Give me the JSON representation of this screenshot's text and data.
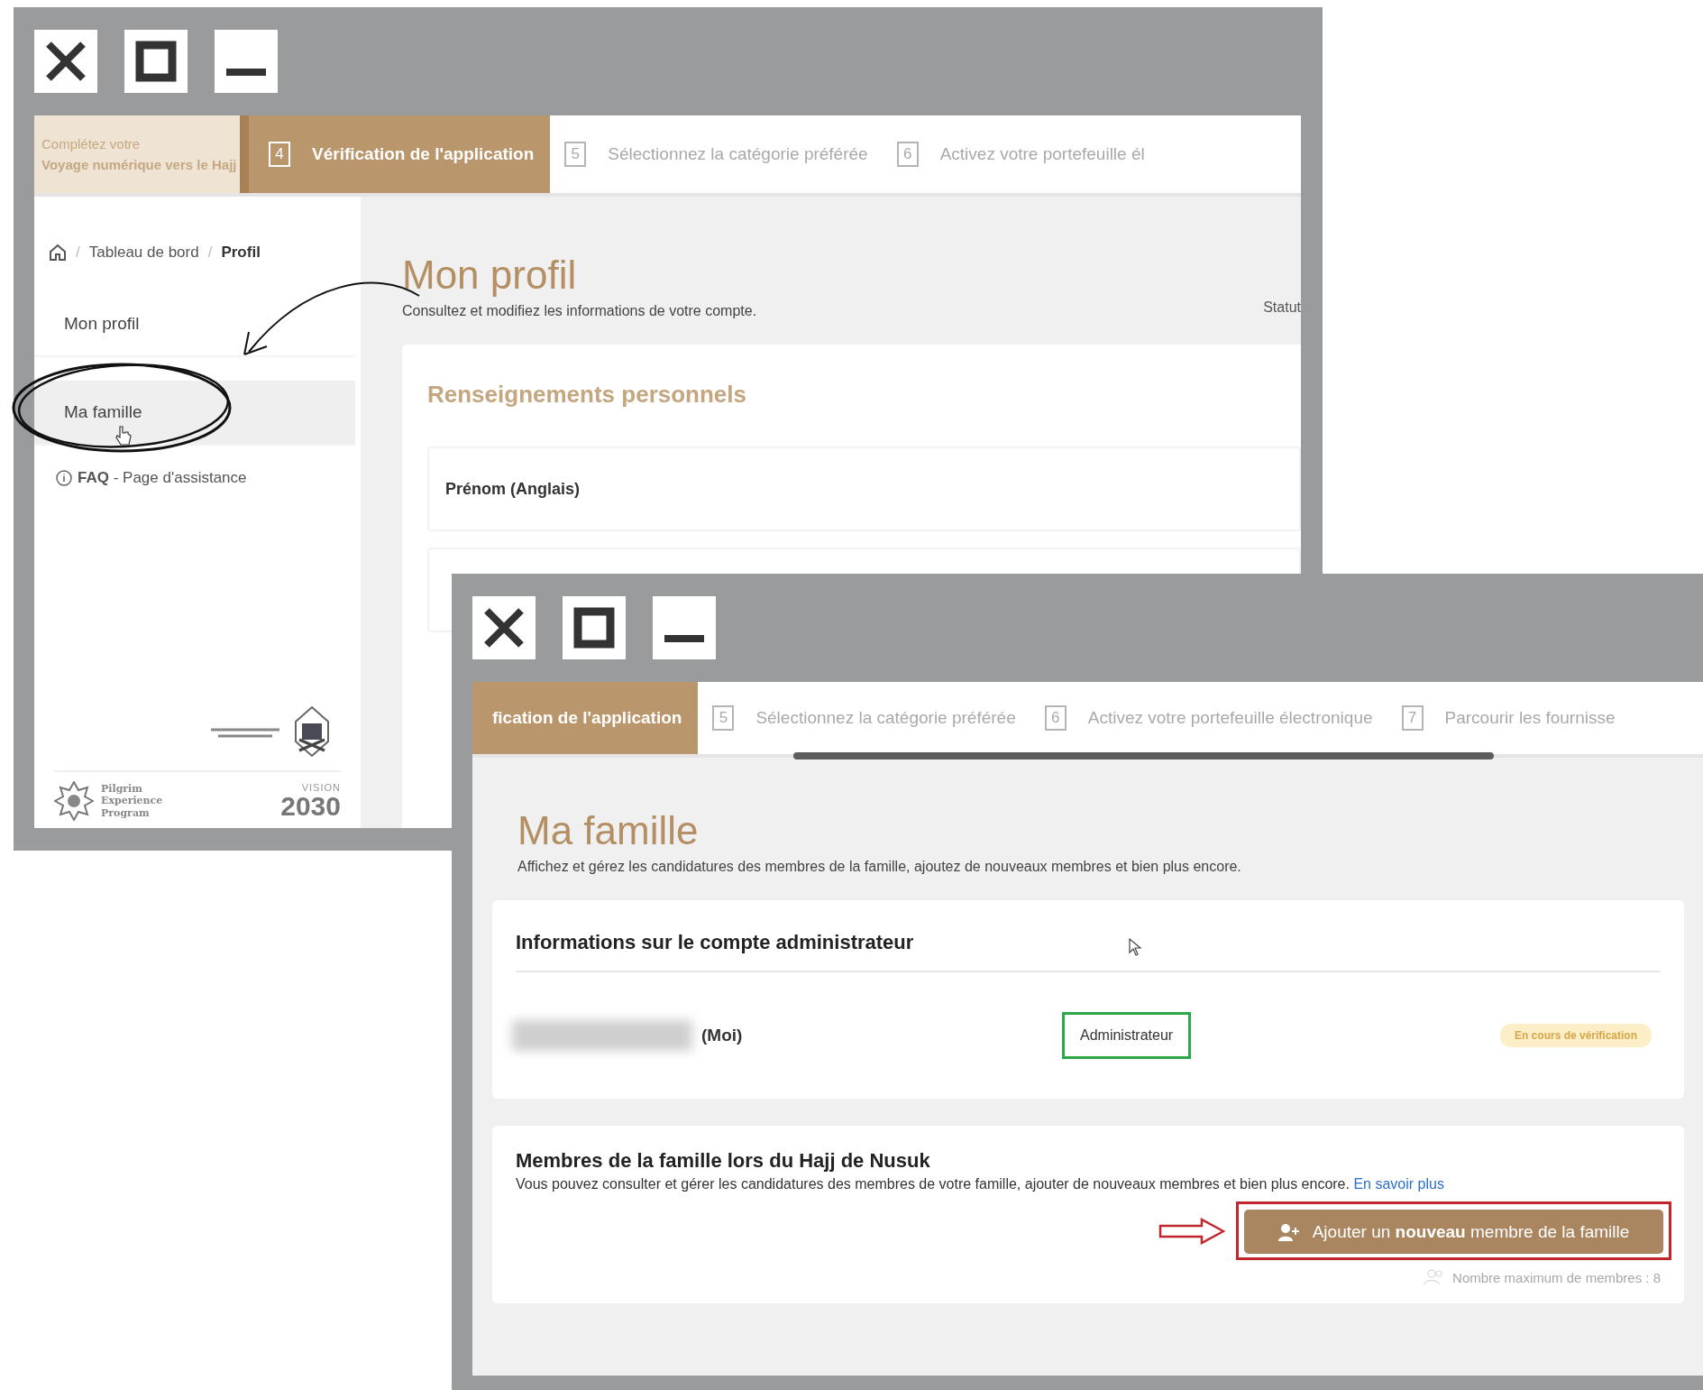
{
  "window_1": {
    "journey_label": {
      "line_1": "Complétez votre",
      "line_2": "Voyage numérique vers le Hajj"
    },
    "steps": [
      {
        "number": "4",
        "label": "Vérification de l'application",
        "selected": true
      },
      {
        "number": "5",
        "label": "Sélectionnez la catégorie préférée",
        "selected": false
      },
      {
        "number": "6",
        "label": "Activez votre portefeuille él",
        "selected": false
      }
    ],
    "breadcrumb": {
      "separator": "/",
      "items": [
        "Tableau de bord",
        "Profil"
      ]
    },
    "sidebar": {
      "items": [
        {
          "label": "Mon profil",
          "selected": false
        },
        {
          "label": "Ma famille",
          "selected": true
        }
      ],
      "help_link": "**FAQ** - Page d'assistance"
    },
    "logos": {
      "pilgrim_program": "Pilgrim Experience Program",
      "vision_word": "VISION",
      "vision_year": "2030"
    },
    "title": "Mon profil",
    "subtitle": "Consultez et modifiez les informations de votre compte.",
    "status_label": "Statut",
    "section_title": "Renseignements personnels",
    "fields": [
      {
        "label": "Prénom (Anglais)"
      }
    ]
  },
  "window_2": {
    "steps": [
      {
        "label": "fication de l'application",
        "selected": true
      },
      {
        "number": "5",
        "label": "Sélectionnez la catégorie préférée",
        "selected": false
      },
      {
        "number": "6",
        "label": "Activez votre portefeuille électronique",
        "selected": false
      },
      {
        "number": "7",
        "label": "Parcourir les fournisse",
        "selected": false
      }
    ],
    "title": "Ma famille",
    "subtitle": "Affichez et gérez les candidatures des membres de la famille, ajoutez de nouveaux membres et bien plus encore.",
    "admin_card": {
      "title": "Informations sur le compte administrateur",
      "member": {
        "name_suffix": "(Moi)",
        "role": "Administrateur",
        "status": "En cours de vérification"
      }
    },
    "members_card": {
      "title": "Membres de la famille lors du Hajj de Nusuk",
      "description": "Vous pouvez consulter et gérer les candidatures des membres de votre famille, ajouter de nouveaux membres et bien plus encore.",
      "link": "En savoir plus",
      "add_button": "Ajouter un **nouveau** membre de la famille",
      "max_members": "Nombre maximum de membres : 8"
    }
  }
}
